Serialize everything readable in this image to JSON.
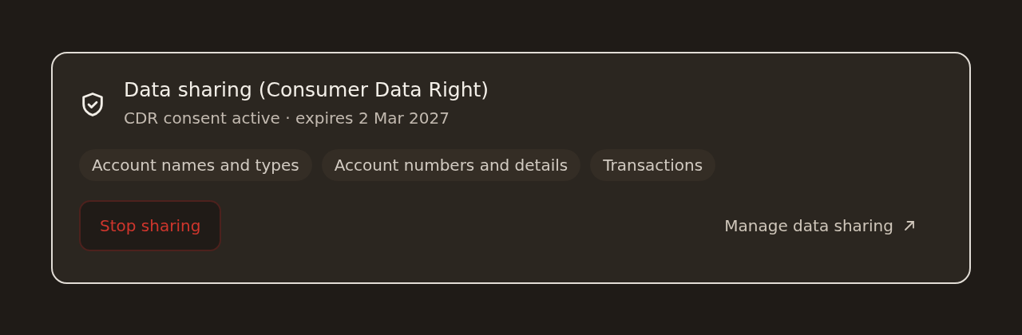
{
  "card": {
    "title": "Data sharing (Consumer Data Right)",
    "subtitle": "CDR consent active · expires 2 Mar 2027",
    "scopes": [
      "Account names and types",
      "Account numbers and details",
      "Transactions"
    ],
    "stop_button": "Stop sharing",
    "manage_link": "Manage data sharing"
  }
}
